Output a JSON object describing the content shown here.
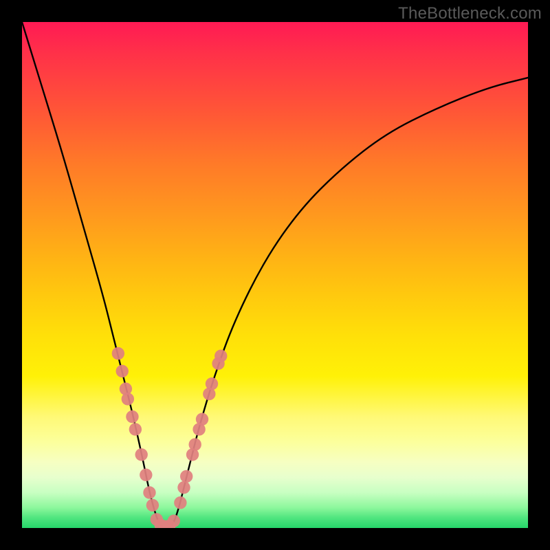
{
  "watermark": "TheBottleneck.com",
  "chart_data": {
    "type": "line",
    "title": "",
    "xlabel": "",
    "ylabel": "",
    "xlim": [
      0,
      100
    ],
    "ylim": [
      0,
      100
    ],
    "series": [
      {
        "name": "bottleneck-curve",
        "x": [
          0,
          4,
          8,
          12,
          16,
          18,
          20,
          22,
          24,
          25,
          26,
          27,
          28,
          29,
          30,
          31,
          32,
          33,
          35,
          38,
          42,
          48,
          55,
          63,
          72,
          82,
          92,
          100
        ],
        "y": [
          100,
          87,
          74,
          60,
          46,
          38,
          30,
          22,
          13,
          8,
          4,
          1,
          0,
          0,
          1,
          4,
          8,
          12,
          20,
          30,
          41,
          53,
          63,
          71,
          78,
          83,
          87,
          89
        ]
      }
    ],
    "marker_clusters": [
      {
        "name": "left-cluster",
        "color": "#e0807f",
        "points": [
          {
            "x": 19.0,
            "y": 34.5
          },
          {
            "x": 19.8,
            "y": 31.0
          },
          {
            "x": 20.5,
            "y": 27.5
          },
          {
            "x": 20.9,
            "y": 25.5
          },
          {
            "x": 21.8,
            "y": 22.0
          },
          {
            "x": 22.4,
            "y": 19.5
          },
          {
            "x": 23.6,
            "y": 14.5
          },
          {
            "x": 24.5,
            "y": 10.5
          },
          {
            "x": 25.2,
            "y": 7.0
          },
          {
            "x": 25.8,
            "y": 4.5
          }
        ]
      },
      {
        "name": "valley-cluster",
        "color": "#e0807f",
        "points": [
          {
            "x": 26.6,
            "y": 1.7
          },
          {
            "x": 27.4,
            "y": 0.6
          },
          {
            "x": 28.3,
            "y": 0.3
          },
          {
            "x": 29.1,
            "y": 0.4
          },
          {
            "x": 30.0,
            "y": 1.4
          }
        ]
      },
      {
        "name": "right-cluster",
        "color": "#e0807f",
        "points": [
          {
            "x": 31.3,
            "y": 5.0
          },
          {
            "x": 32.0,
            "y": 8.0
          },
          {
            "x": 32.5,
            "y": 10.2
          },
          {
            "x": 33.7,
            "y": 14.5
          },
          {
            "x": 34.2,
            "y": 16.5
          },
          {
            "x": 35.0,
            "y": 19.5
          },
          {
            "x": 35.6,
            "y": 21.5
          },
          {
            "x": 37.0,
            "y": 26.5
          },
          {
            "x": 37.5,
            "y": 28.5
          },
          {
            "x": 38.8,
            "y": 32.5
          },
          {
            "x": 39.3,
            "y": 34.0
          }
        ]
      }
    ]
  }
}
